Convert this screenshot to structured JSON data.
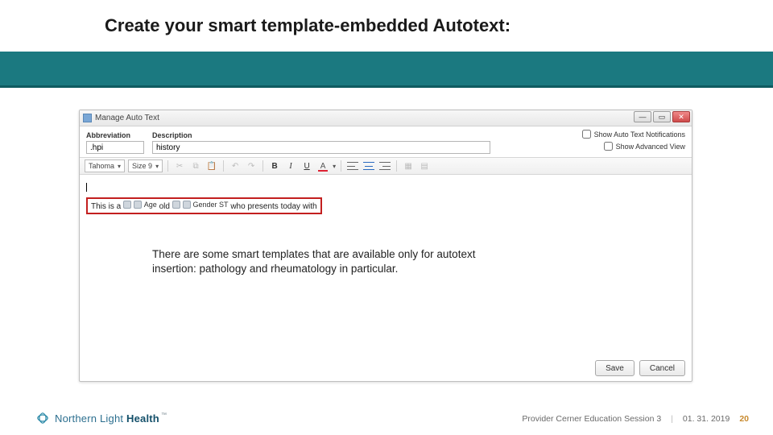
{
  "slide": {
    "title": "Create your smart template-embedded Autotext:"
  },
  "window": {
    "title": "Manage Auto Text",
    "checkboxes": {
      "show_notifications": "Show Auto Text Notifications",
      "show_advanced": "Show Advanced View"
    },
    "fields": {
      "abbrev_label": "Abbreviation",
      "abbrev_value": ".hpi",
      "desc_label": "Description",
      "desc_value": "history"
    },
    "toolbar": {
      "font": "Tahoma",
      "size": "Size 9"
    },
    "template_segments": {
      "lead": "This is a",
      "age_chip": "Age",
      "old": "old",
      "gender_chip": "Gender ST",
      "tail": "who presents today with"
    },
    "buttons": {
      "save": "Save",
      "cancel": "Cancel"
    }
  },
  "note": "There are some smart templates that are available only for autotext insertion: pathology and rheumatology in particular.",
  "footer": {
    "brand_light": "Northern Light",
    "brand_bold": "Health",
    "session": "Provider Cerner Education Session 3",
    "date": "01. 31. 2019",
    "page": "20"
  }
}
